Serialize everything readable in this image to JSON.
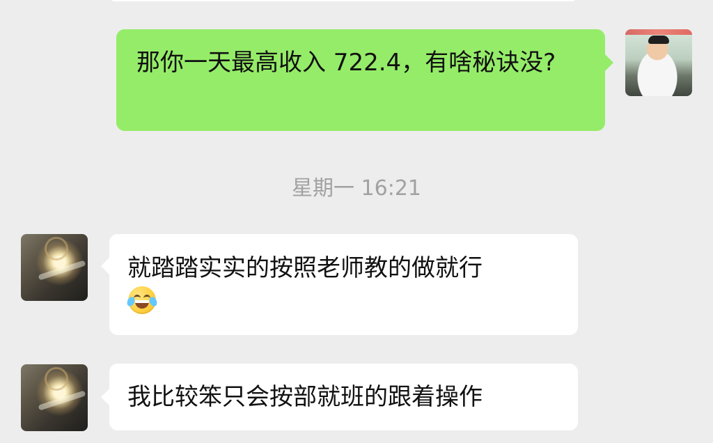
{
  "chat": {
    "outgoing": {
      "text": "那你一天最高收入 722.4，有啥秘诀没?"
    },
    "timestamp": "星期一 16:21",
    "incoming": [
      {
        "text": "就踏踏实实的按照老师教的做就行",
        "emoji": "grinning-squinting-tears-emoji"
      },
      {
        "text": "我比较笨只会按部就班的跟着操作"
      }
    ]
  },
  "colors": {
    "background": "#ededed",
    "outgoing_bubble": "#95ec69",
    "incoming_bubble": "#ffffff",
    "timestamp_text": "#a1a1a1",
    "message_text": "#111111"
  }
}
